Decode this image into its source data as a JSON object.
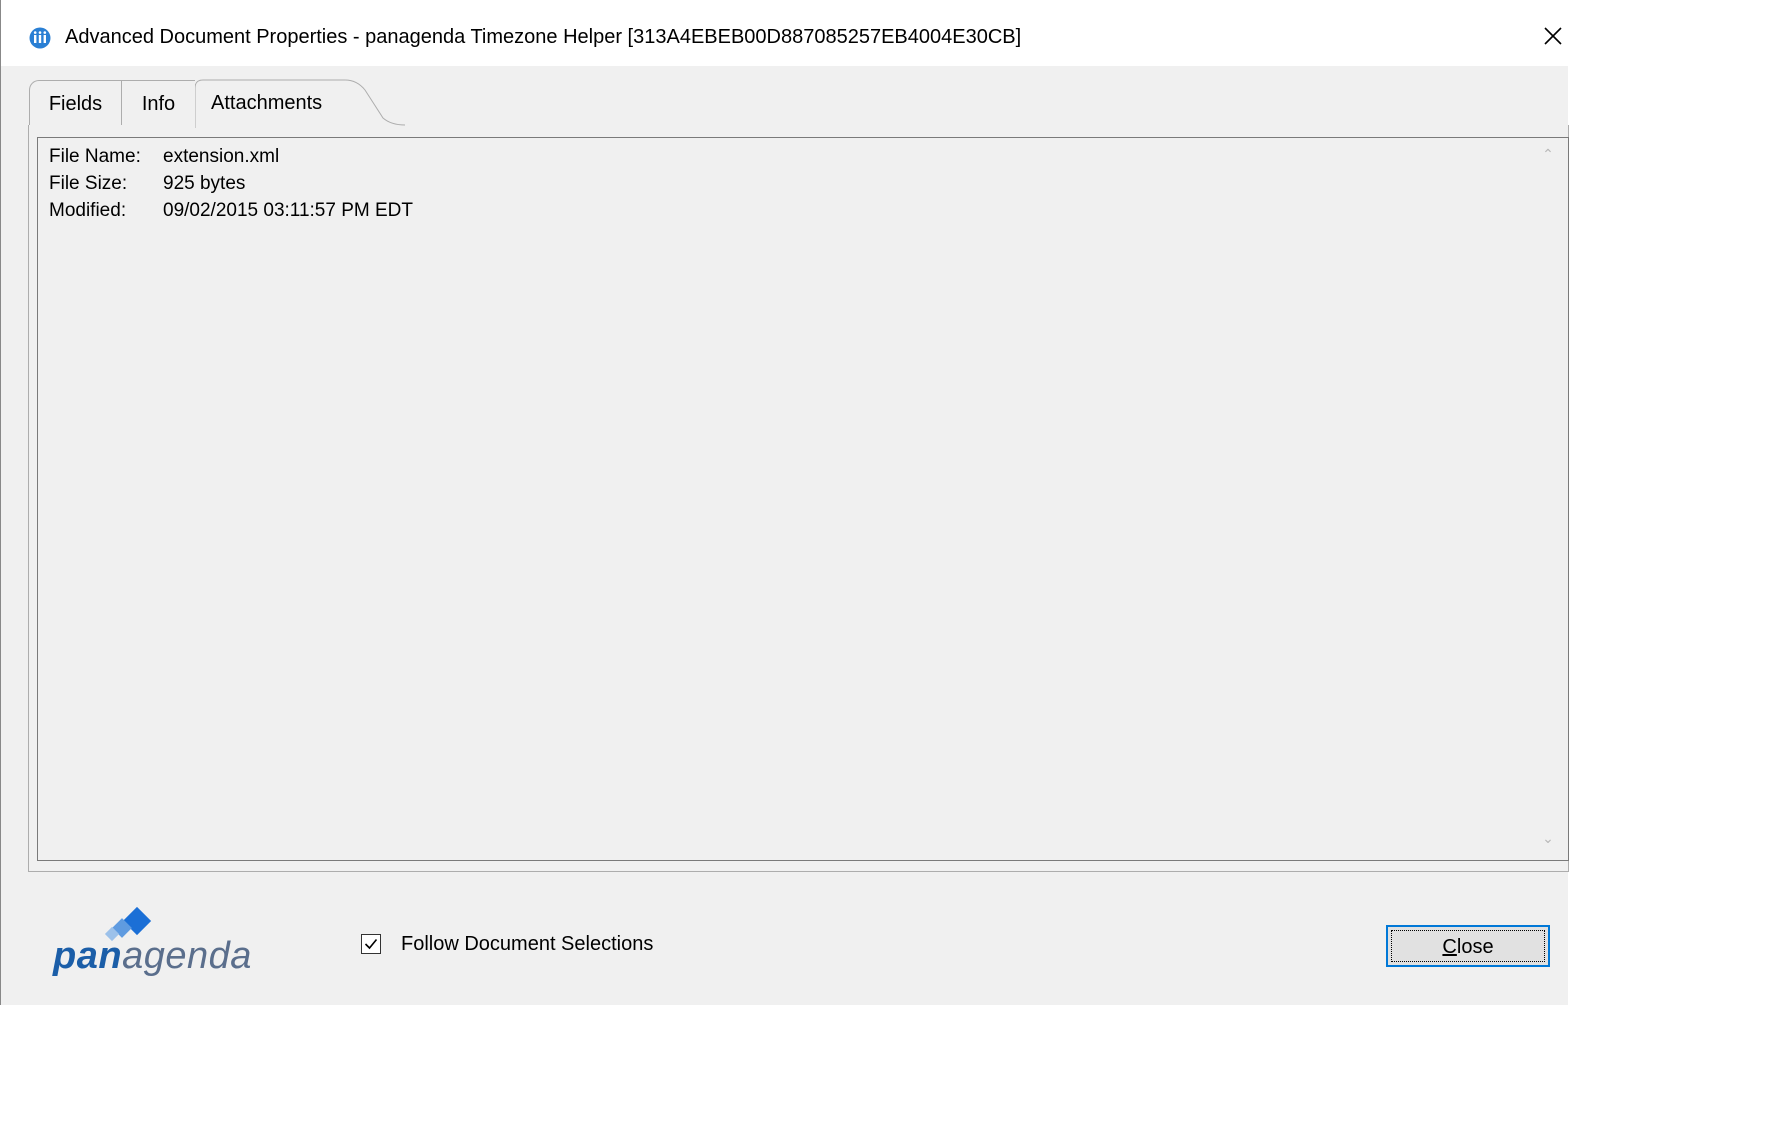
{
  "window": {
    "title": "Advanced Document Properties - panagenda Timezone Helper [313A4EBEB00D887085257EB4004E30CB]",
    "app_icon": "iii-app-icon",
    "close_icon": "close-icon"
  },
  "tabs": [
    {
      "label": "Fields",
      "selected": false
    },
    {
      "label": "Info",
      "selected": false
    },
    {
      "label": "Attachments",
      "selected": true
    }
  ],
  "attachment": {
    "rows": [
      {
        "label": "File Name:",
        "value": "extension.xml"
      },
      {
        "label": "File Size:",
        "value": "925 bytes"
      },
      {
        "label": "Modified:",
        "value": "09/02/2015 03:11:57 PM EDT"
      }
    ]
  },
  "footer": {
    "logo_bold": "pan",
    "logo_light": "agenda",
    "follow_label": "Follow Document Selections",
    "follow_checked": true,
    "close_first": "C",
    "close_rest": "lose"
  },
  "colors": {
    "logo_blue": "#1b5ea8",
    "focus_border": "#0078d7"
  }
}
